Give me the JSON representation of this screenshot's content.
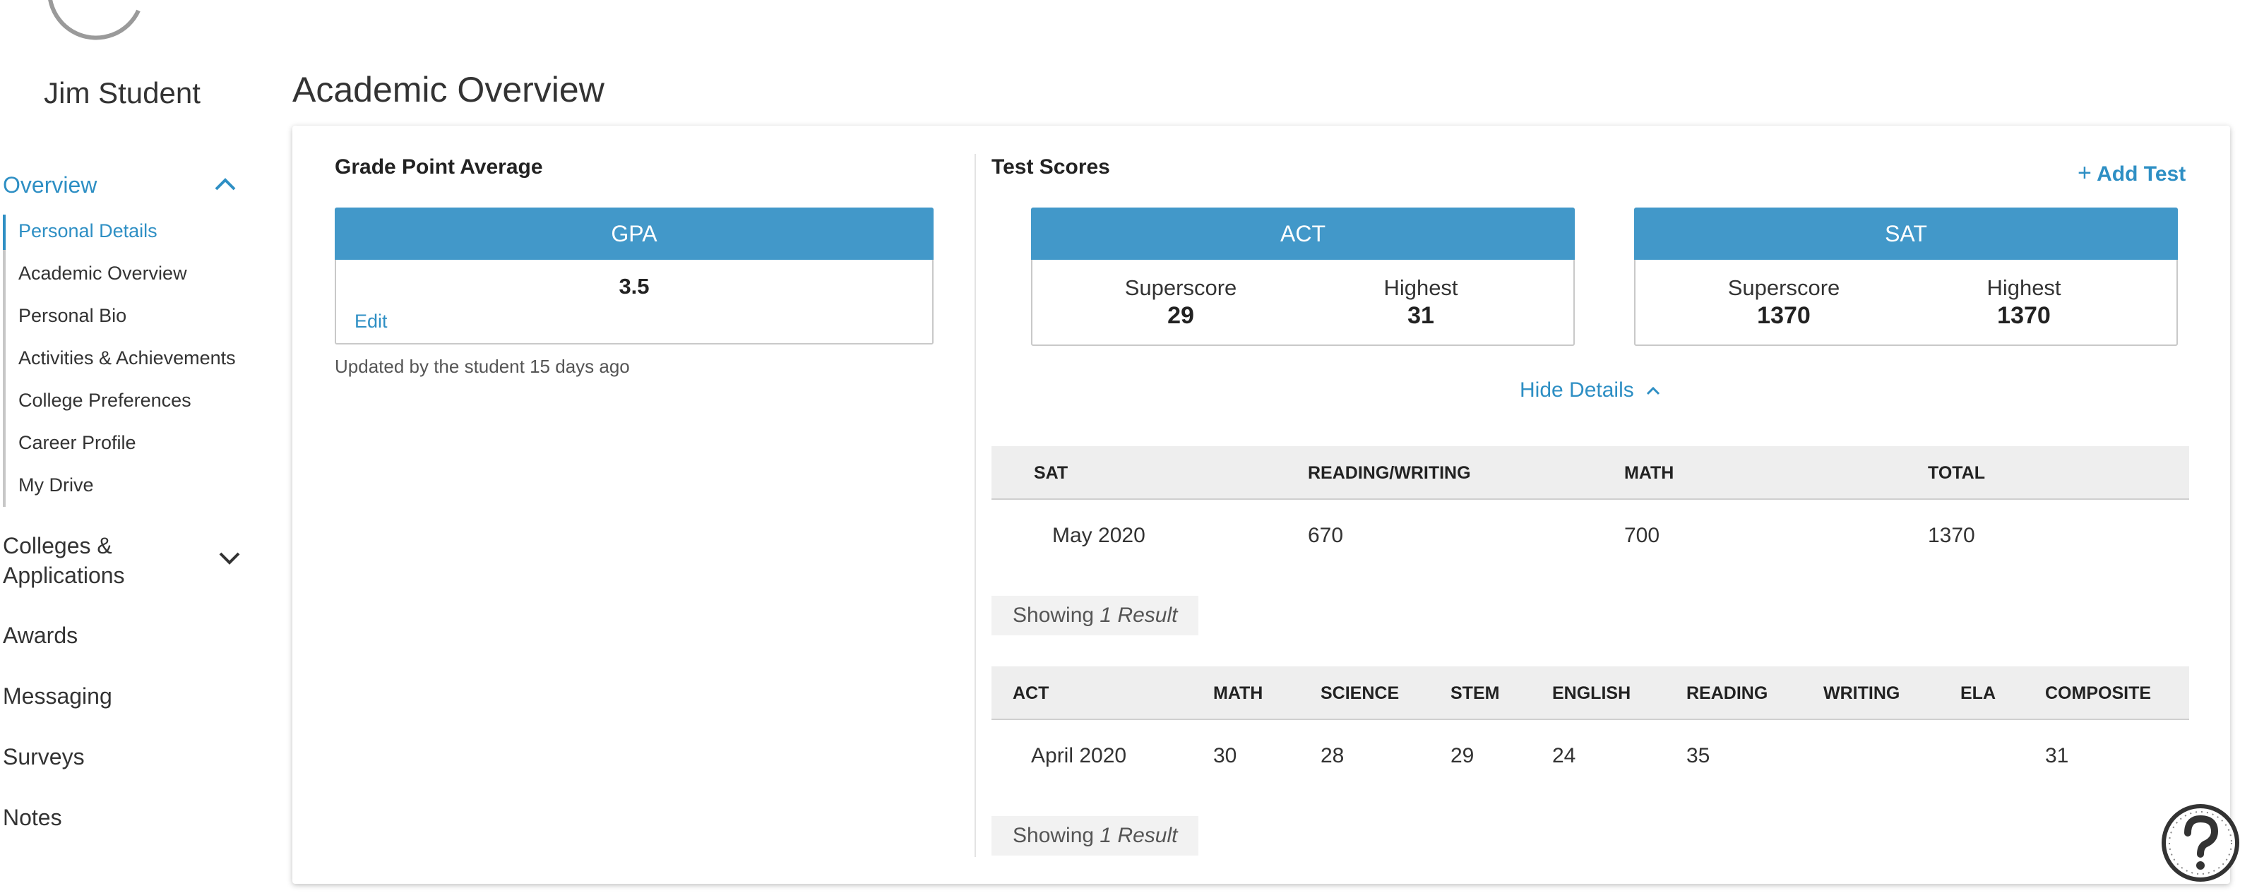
{
  "sidebar": {
    "student_name": "Jim Student",
    "overview_label": "Overview",
    "sub_items": [
      {
        "label": "Personal Details"
      },
      {
        "label": "Academic Overview"
      },
      {
        "label": "Personal Bio"
      },
      {
        "label": "Activities & Achievements"
      },
      {
        "label": "College Preferences"
      },
      {
        "label": "Career Profile"
      },
      {
        "label": "My Drive"
      }
    ],
    "colleges_label_line1": "Colleges &",
    "colleges_label_line2": "Applications",
    "awards_label": "Awards",
    "messaging_label": "Messaging",
    "surveys_label": "Surveys",
    "notes_label": "Notes"
  },
  "page": {
    "title": "Academic Overview"
  },
  "gpa": {
    "section_title": "Grade Point Average",
    "box_title": "GPA",
    "value": "3.5",
    "edit_label": "Edit",
    "updated_text": "Updated by the student 15 days ago"
  },
  "tests": {
    "section_title": "Test Scores",
    "add_test_label": "Add Test",
    "act": {
      "title": "ACT",
      "superscore_label": "Superscore",
      "superscore": "29",
      "highest_label": "Highest",
      "highest": "31"
    },
    "sat": {
      "title": "SAT",
      "superscore_label": "Superscore",
      "superscore": "1370",
      "highest_label": "Highest",
      "highest": "1370"
    },
    "hide_details_label": "Hide Details",
    "sat_table": {
      "headers": [
        "SAT",
        "READING/WRITING",
        "MATH",
        "TOTAL"
      ],
      "rows": [
        {
          "date": "May 2020",
          "reading_writing": "670",
          "math": "700",
          "total": "1370"
        }
      ],
      "showing_prefix": "Showing",
      "showing_count": "1 Result"
    },
    "act_table": {
      "headers": [
        "ACT",
        "MATH",
        "SCIENCE",
        "STEM",
        "ENGLISH",
        "READING",
        "WRITING",
        "ELA",
        "COMPOSITE"
      ],
      "rows": [
        {
          "date": "April 2020",
          "math": "30",
          "science": "28",
          "stem": "29",
          "english": "24",
          "reading": "35",
          "writing": "",
          "ela": "",
          "composite": "31"
        }
      ],
      "showing_prefix": "Showing",
      "showing_count": "1 Result"
    }
  },
  "icons": {
    "avatar": "avatar-icon",
    "chevron_up": "chevron-up-icon",
    "chevron_down": "chevron-down-icon",
    "plus": "plus-icon",
    "help": "help-icon"
  },
  "colors": {
    "accent": "#2e8fc4",
    "header_blue": "#4298c9"
  }
}
